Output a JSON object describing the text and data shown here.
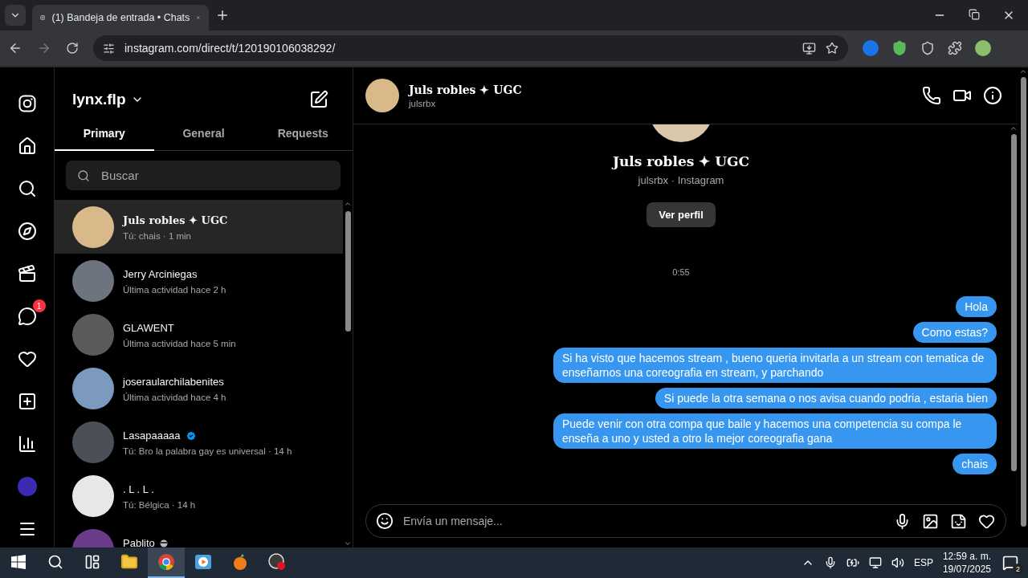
{
  "browser": {
    "tab_title": "(1) Bandeja de entrada • Chats",
    "url": "instagram.com/direct/t/120190106038292/"
  },
  "nav": [
    {
      "kind": "logo"
    },
    {
      "kind": "home"
    },
    {
      "kind": "search"
    },
    {
      "kind": "explore"
    },
    {
      "kind": "reels"
    },
    {
      "kind": "messages",
      "badge": "1"
    },
    {
      "kind": "notifications"
    },
    {
      "kind": "create"
    },
    {
      "kind": "dashboard"
    },
    {
      "kind": "profile"
    },
    {
      "kind": "more"
    }
  ],
  "inbox": {
    "username": "lynx.flp",
    "tabs": [
      {
        "label": "Primary",
        "selected": true
      },
      {
        "label": "General",
        "selected": false
      },
      {
        "label": "Requests",
        "selected": false
      }
    ],
    "search": {
      "placeholder": "Buscar"
    },
    "conversations": [
      {
        "name": "Juls robles ✦ UGC",
        "preview": "Tú: chais · 1 min",
        "selected": true,
        "verified": false,
        "emoji": false,
        "photo": true
      },
      {
        "name": "Jerry Arciniegas",
        "preview": "Última actividad hace 2 h",
        "selected": false,
        "verified": false,
        "emoji": false,
        "photo": true
      },
      {
        "name": "GLAWENT",
        "preview": "Última actividad hace 5 min",
        "selected": false,
        "verified": false,
        "emoji": false,
        "photo": true
      },
      {
        "name": "joseraularchilabenites",
        "preview": "Última actividad hace 4 h",
        "selected": false,
        "verified": false,
        "emoji": false,
        "photo": true
      },
      {
        "name": "Lasapaaaaa",
        "preview": "Tú: Bro la palabra gay es universal · 14 h",
        "selected": false,
        "verified": true,
        "emoji": false,
        "photo": true
      },
      {
        "name": ". L . L .",
        "preview": "Tú: Bélgica · 14 h",
        "selected": false,
        "verified": false,
        "emoji": false,
        "photo": false
      },
      {
        "name": "Pablito",
        "selected": false,
        "verified": false,
        "emoji": true,
        "photo": true
      }
    ]
  },
  "chat": {
    "name": "Juls robles ✦ UGC",
    "handle": "julsrbx",
    "profile_name": "Juls robles ✦ UGC",
    "profile_sub": "julsrbx · Instagram",
    "profile_button": "Ver perfil",
    "timestamp": "0:55",
    "messages": [
      {
        "text": "Hola"
      },
      {
        "text": "Como estas?"
      },
      {
        "text": "Si ha visto que hacemos stream , bueno queria invitarla a un stream con tematica de enseñarnos una coreografia en stream, y parchando"
      },
      {
        "text": "Si puede la otra semana o nos avisa cuando podria , estaria bien"
      },
      {
        "text": "Puede venir con otra compa que baile y hacemos una competencia su compa le enseña a uno y usted a otro la mejor coreografia gana"
      },
      {
        "text": "chais"
      }
    ],
    "composer": {
      "placeholder": "Envía un mensaje..."
    }
  },
  "taskbar": {
    "apps": [
      {
        "kind": "start",
        "selected": false
      },
      {
        "kind": "search",
        "selected": false
      },
      {
        "kind": "taskview",
        "selected": false
      },
      {
        "kind": "files",
        "selected": false
      },
      {
        "kind": "chrome",
        "selected": true
      },
      {
        "kind": "player",
        "selected": false
      },
      {
        "kind": "fruit",
        "selected": false
      },
      {
        "kind": "recorder",
        "selected": false
      }
    ],
    "language": "ESP",
    "time": "12:59 a. m.",
    "date": "19/07/2025",
    "notifications": "2"
  }
}
